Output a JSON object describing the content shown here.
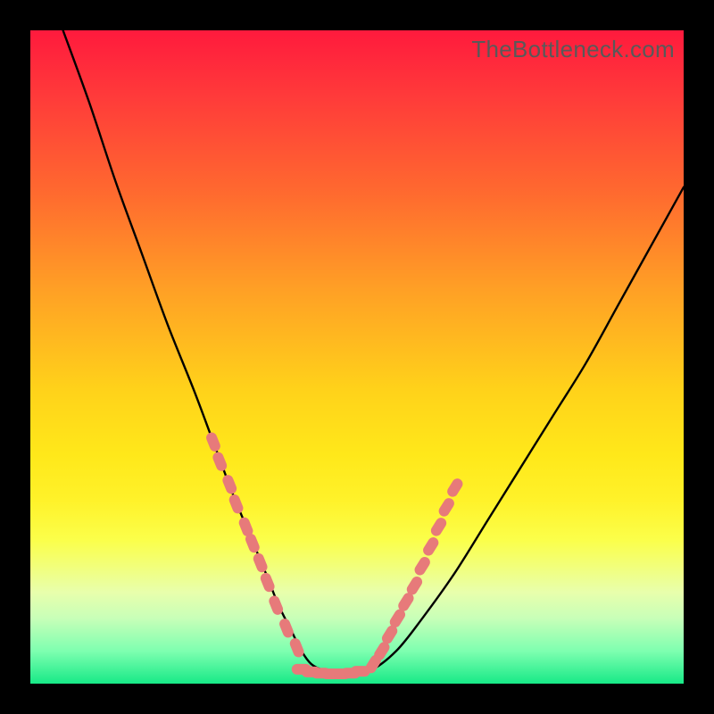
{
  "watermark": "TheBottleneck.com",
  "colors": {
    "frame": "#000000",
    "gradient_top": "#ff1a3d",
    "gradient_bottom": "#17e987",
    "curve": "#000000",
    "markers": "#e77a7a",
    "watermark": "#595959"
  },
  "chart_data": {
    "type": "line",
    "title": "",
    "xlabel": "",
    "ylabel": "",
    "xlim": [
      0,
      100
    ],
    "ylim": [
      0,
      100
    ],
    "grid": false,
    "legend": false,
    "note": "Bottleneck-style V curve; y encodes mismatch (0 at floor). Values approximate from pixels.",
    "series": [
      {
        "name": "curve",
        "x": [
          5,
          9,
          13,
          17,
          21,
          25,
          28,
          31,
          33.5,
          36,
          38,
          40,
          41.5,
          43,
          45,
          48,
          52,
          56,
          60,
          65,
          70,
          75,
          80,
          85,
          90,
          95,
          100
        ],
        "y": [
          100,
          89,
          77,
          66,
          55,
          45,
          37,
          29,
          23,
          17,
          12,
          8,
          5,
          3,
          2,
          1.5,
          2,
          5,
          10,
          17,
          25,
          33,
          41,
          49,
          58,
          67,
          76
        ]
      }
    ],
    "markers_left": {
      "name": "left-cluster",
      "x": [
        28.0,
        29.0,
        30.5,
        31.5,
        33.0,
        34.0,
        35.2,
        36.3,
        37.6,
        39.2,
        40.8
      ],
      "y": [
        37.0,
        34.0,
        30.5,
        27.5,
        24.0,
        21.5,
        18.5,
        15.5,
        12.0,
        8.5,
        5.5
      ]
    },
    "markers_right": {
      "name": "right-cluster",
      "x": [
        52.5,
        53.8,
        55.0,
        56.2,
        57.5,
        58.8,
        60.0,
        61.3,
        62.5,
        63.7,
        65.0
      ],
      "y": [
        3.0,
        5.0,
        7.5,
        10.0,
        12.5,
        15.0,
        18.0,
        21.0,
        24.0,
        27.0,
        30.0
      ]
    },
    "markers_bottom": {
      "name": "floor-cluster",
      "x": [
        41.5,
        43.0,
        44.5,
        46.0,
        47.5,
        49.0,
        50.5
      ],
      "y": [
        2.2,
        1.8,
        1.6,
        1.5,
        1.5,
        1.6,
        1.9
      ]
    }
  }
}
